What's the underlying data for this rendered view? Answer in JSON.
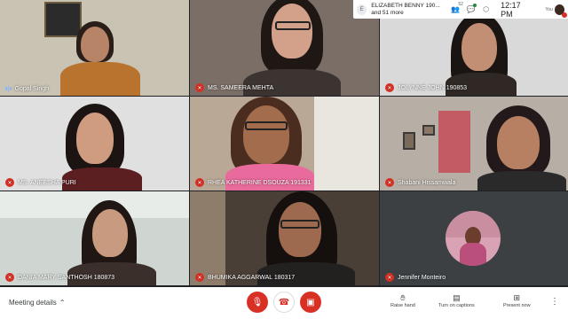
{
  "notification": {
    "initial": "E",
    "line1": "ELIZABETH BENNY 190...",
    "line2": "and 51 more",
    "people_count": "52",
    "time": "12:17 PM",
    "you_label": "You"
  },
  "participants": [
    {
      "name": "Gopal Singh",
      "muted": false,
      "speaking": true
    },
    {
      "name": "MS. SAMEERA MEHTA",
      "muted": true
    },
    {
      "name": "JOLYNNE JOHN 190853",
      "muted": true
    },
    {
      "name": "MS. ANEESHA PURI",
      "muted": true
    },
    {
      "name": "RHEA KATHERINE DSOUZA 191331",
      "muted": true
    },
    {
      "name": "Shabani Hissamwala",
      "muted": true
    },
    {
      "name": "DANIA MARY SANTHOSH 180873",
      "muted": true
    },
    {
      "name": "BHUMIKA AGGARWAL 180317",
      "muted": true
    },
    {
      "name": "Jennifer Monteiro",
      "muted": true
    }
  ],
  "bottom_bar": {
    "meeting_details": "Meeting details",
    "raise_hand": "Raise hand",
    "captions": "Turn on captions",
    "present": "Present now"
  },
  "icons": {
    "mic_off": "mic-off-icon",
    "hangup": "hangup-icon",
    "cam_off": "camera-off-icon",
    "raise_hand": "hand-icon",
    "captions": "captions-icon",
    "present": "present-icon",
    "more": "more-vert-icon"
  },
  "colors": {
    "red": "#d93025",
    "background": "#202124",
    "tile": "#3c4043",
    "speaking": "#8ab4f8"
  }
}
